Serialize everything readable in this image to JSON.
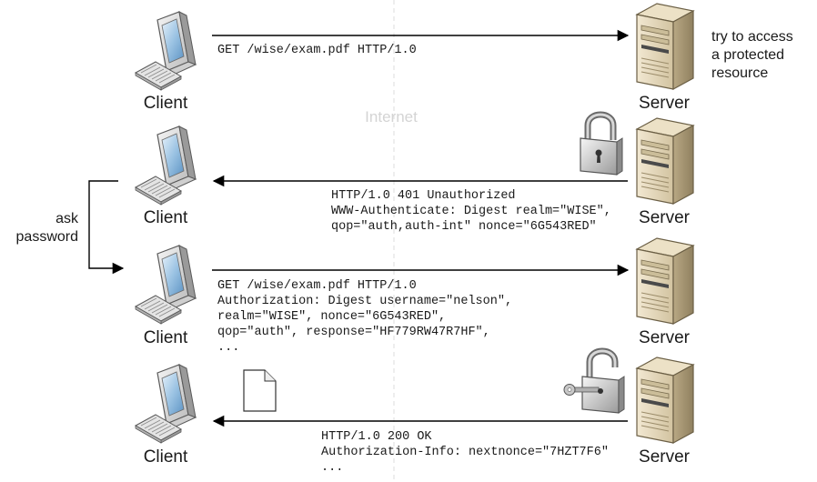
{
  "labels": {
    "client": "Client",
    "server": "Server",
    "internet": "Internet"
  },
  "notes": {
    "server_note": [
      "try to access",
      "a protected",
      "resource"
    ],
    "client_note": [
      "ask",
      "password"
    ]
  },
  "messages": {
    "m1": [
      "GET /wise/exam.pdf HTTP/1.0"
    ],
    "m2": [
      "HTTP/1.0 401 Unauthorized",
      "WWW-Authenticate: Digest realm=\"WISE\",",
      "qop=\"auth,auth-int\" nonce=\"6G543RED\""
    ],
    "m3": [
      "GET /wise/exam.pdf HTTP/1.0",
      "Authorization: Digest username=\"nelson\",",
      "realm=\"WISE\", nonce=\"6G543RED\",",
      "qop=\"auth\", response=\"HF779RW47R7HF\",",
      "..."
    ],
    "m4": [
      "HTTP/1.0 200 OK",
      "Authorization-Info: nextnonce=\"7HZT7F6\"",
      "..."
    ]
  },
  "icons": {
    "client": "computer-icon",
    "server": "server-tower-icon",
    "lock_closed": "padlock-icon",
    "lock_open": "unlocked-padlock-with-key-icon",
    "document": "document-icon"
  }
}
